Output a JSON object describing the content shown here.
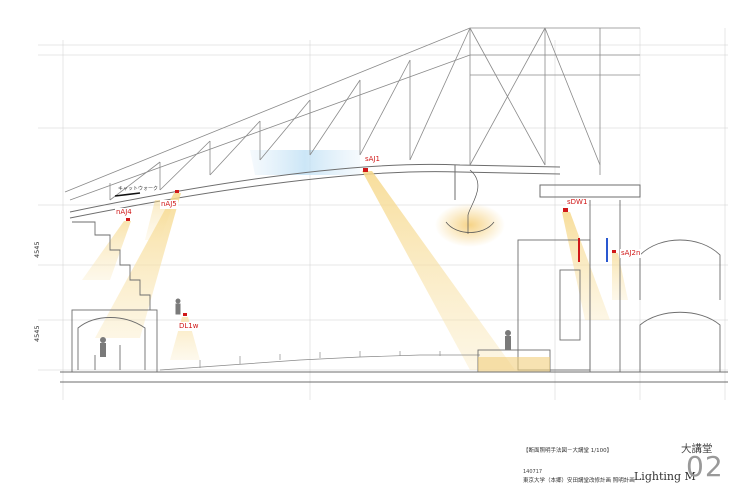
{
  "fixtures": [
    {
      "id": "sAJ1",
      "label": "sAJ1"
    },
    {
      "id": "nAJ5",
      "label": "nAJ5"
    },
    {
      "id": "nAJ4",
      "label": "nAJ4"
    },
    {
      "id": "sDW1",
      "label": "sDW1"
    },
    {
      "id": "sAJ2n",
      "label": "sAJ2n"
    },
    {
      "id": "DL1w",
      "label": "DL1w"
    }
  ],
  "dimensions": {
    "upper": "4545",
    "lower": "4545"
  },
  "catwalk_note": "キャットウォーク",
  "title_block": {
    "title": "【断面照明手法図－大講堂 1/100】",
    "date": "140717",
    "project": "東京大学（本郷）安田講堂改修計画 照明計画",
    "room": "大講堂",
    "discipline": "Lighting M",
    "sheet": "02"
  },
  "colors": {
    "beam": "#f4d27a",
    "marker": "#d01818",
    "sky": "#cfe6f6",
    "line": "#7a7a7a"
  }
}
